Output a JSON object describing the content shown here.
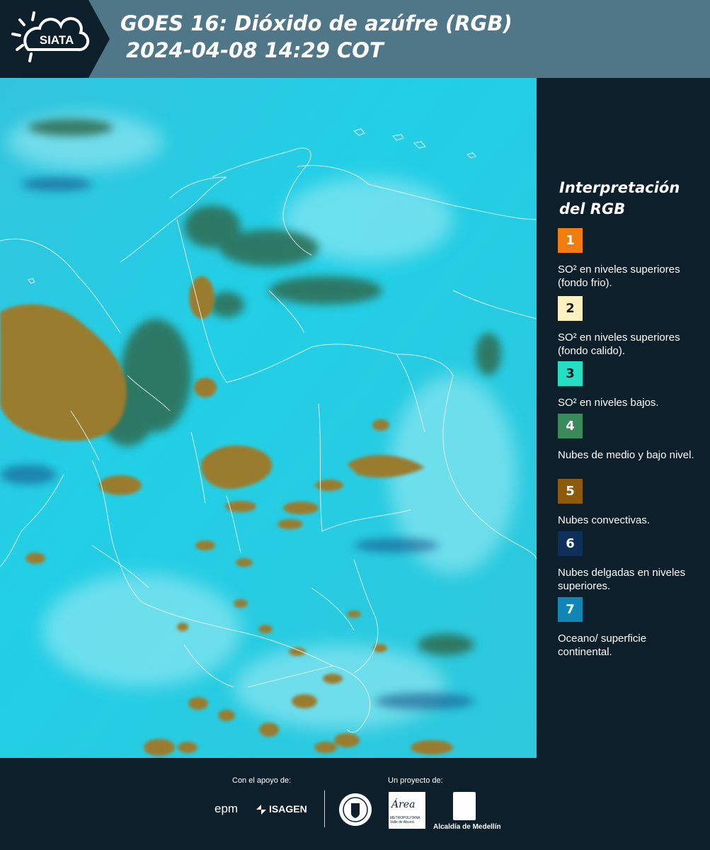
{
  "header": {
    "logo_text": "SIATA",
    "title_line1": "GOES 16: Dióxido de azúfre (RGB)",
    "title_line2": "2024-04-08 14:29 COT"
  },
  "legend": {
    "title": "Interpretación del RGB",
    "items": [
      {
        "number": "1",
        "color": "#f07d0e",
        "label": "SO² en niveles superiores (fondo frio)."
      },
      {
        "number": "2",
        "color": "#fdf1bf",
        "label": "SO² en niveles superiores (fondo calido)."
      },
      {
        "number": "3",
        "color": "#25dfc4",
        "label": "SO² en niveles bajos."
      },
      {
        "number": "4",
        "color": "#3a8a5b",
        "label": "Nubes de medio y bajo nivel."
      },
      {
        "number": "5",
        "color": "#8c5b0e",
        "label": "Nubes convectivas."
      },
      {
        "number": "6",
        "color": "#0e2f5a",
        "label": "Nubes delgadas en niveles superiores."
      },
      {
        "number": "7",
        "color": "#1186b5",
        "label": "Oceano/ superficie continental."
      }
    ]
  },
  "footer": {
    "support_label": "Con el apoyo de:",
    "project_label": "Un proyecto de:",
    "sponsors": [
      "epm",
      "ISAGEN"
    ],
    "partners": [
      "METROPOLITANA Valle de Aburrá",
      "Alcaldía de Medellín"
    ],
    "area_logo_text": "Área"
  }
}
